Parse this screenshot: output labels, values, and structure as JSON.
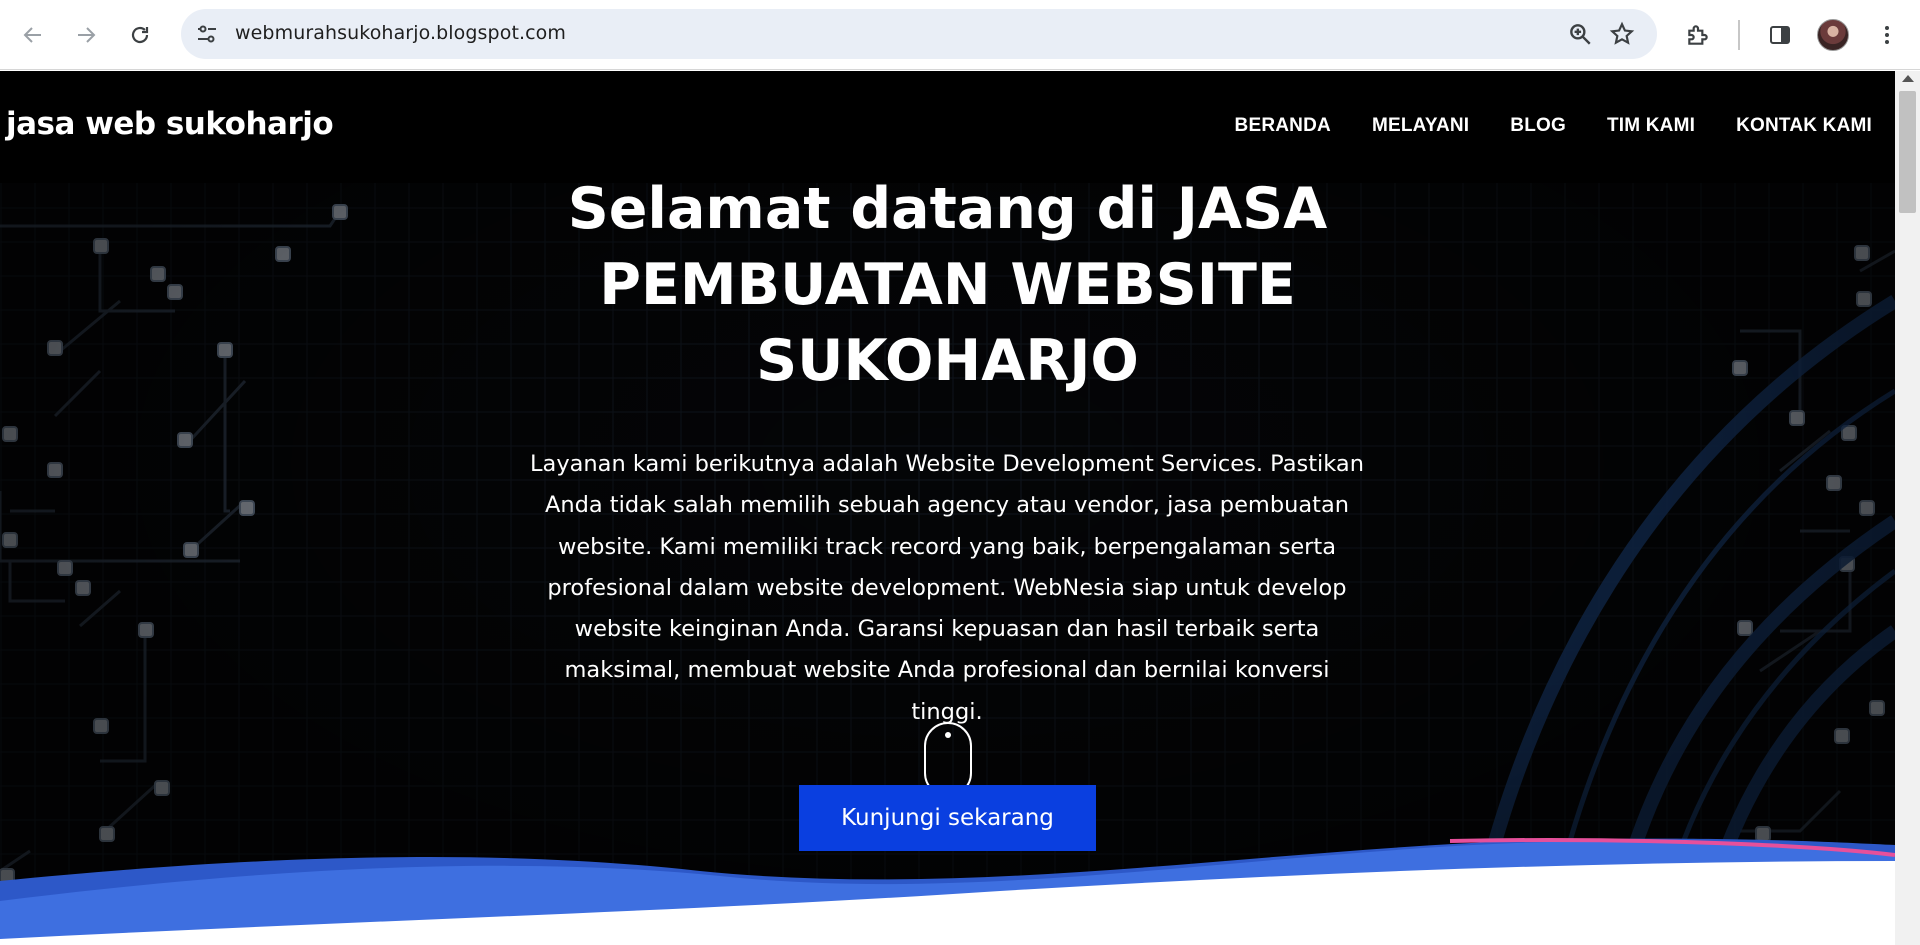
{
  "browser": {
    "url": "webmurahsukoharjo.blogspot.com",
    "icons": [
      "back-icon",
      "forward-icon",
      "reload-icon",
      "tune-icon",
      "zoom-icon",
      "star-icon",
      "extensions-icon",
      "side-panel-icon",
      "profile-avatar",
      "more-menu-icon"
    ]
  },
  "site": {
    "brand": "jasa web sukoharjo",
    "nav": [
      {
        "label": "BERANDA"
      },
      {
        "label": "MELAYANI"
      },
      {
        "label": "BLOG"
      },
      {
        "label": "TIM KAMI"
      },
      {
        "label": "KONTAK KAMI"
      }
    ]
  },
  "hero": {
    "title_lines": [
      "Selamat datang di JASA",
      "PEMBUATAN WEBSITE",
      "SUKOHARJO"
    ],
    "text_lines": [
      "Layanan kami berikutnya adalah Website Development Services. Pastikan",
      "Anda tidak salah memilih sebuah agency atau vendor, jasa pembuatan",
      "website. Kami memiliki track record yang baik, berpengalaman serta",
      "profesional dalam website development. WebNesia siap untuk develop",
      "website keinginan Anda. Garansi kepuasan dan hasil terbaik serta",
      "maksimal, membuat website Anda profesional dan bernilai konversi",
      "tinggi."
    ],
    "cta_label": "Kunjungi sekarang"
  },
  "colors": {
    "cta": "#0a3fe0",
    "wave_main": "#3e6fe0",
    "wave_dark": "#2d58c8",
    "wave_accent": "#e6509b"
  }
}
